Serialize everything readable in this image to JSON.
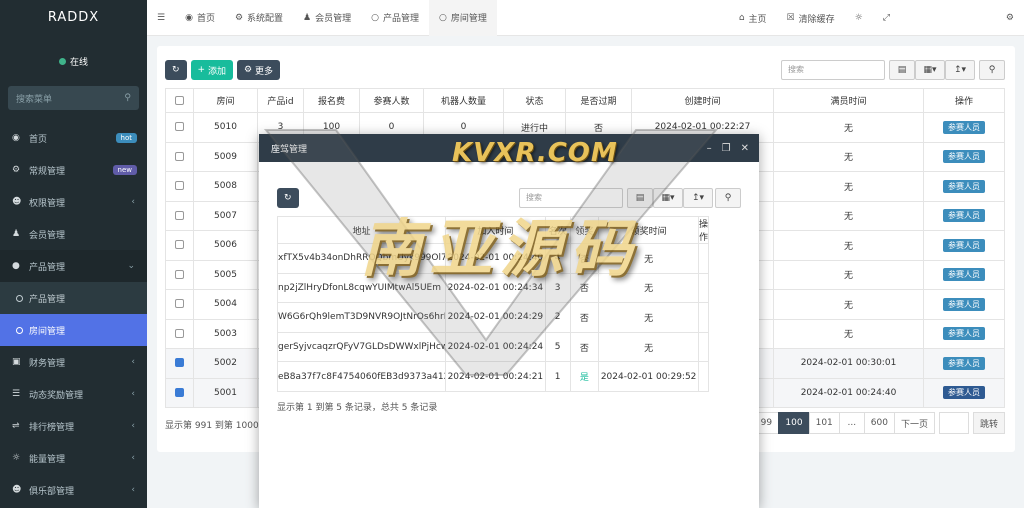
{
  "app": {
    "brand": "RADDX"
  },
  "user": {
    "status": "在线"
  },
  "sidebar": {
    "search_placeholder": "搜索菜单",
    "items": [
      {
        "label": "首页",
        "badge": "hot"
      },
      {
        "label": "常规管理",
        "badge": "new"
      },
      {
        "label": "权限管理"
      },
      {
        "label": "会员管理"
      },
      {
        "label": "产品管理"
      },
      {
        "label": "产品管理"
      },
      {
        "label": "房间管理"
      },
      {
        "label": "财务管理"
      },
      {
        "label": "动态奖励管理"
      },
      {
        "label": "排行榜管理"
      },
      {
        "label": "能量管理"
      },
      {
        "label": "俱乐部管理"
      }
    ]
  },
  "topbar": {
    "tabs": [
      "首页",
      "系统配置",
      "会员管理",
      "产品管理",
      "房间管理"
    ],
    "right": [
      "主页",
      "清除缓存"
    ]
  },
  "toolbar": {
    "add": "添加",
    "more": "更多",
    "search_placeholder": "搜索"
  },
  "table": {
    "headers": [
      "房间",
      "产品id",
      "报名费",
      "参赛人数",
      "机器人数量",
      "状态",
      "是否过期",
      "创建时间",
      "满员时间",
      "操作"
    ],
    "rows": [
      {
        "room": "5010",
        "pid": "3",
        "fee": "100",
        "players": "0",
        "bots": "0",
        "status": "进行中",
        "expired": "否",
        "created": "2024-02-01 00:22:27",
        "full": "无",
        "action": "参赛人员"
      },
      {
        "room": "5009",
        "full": "无",
        "action": "参赛人员"
      },
      {
        "room": "5008",
        "full": "无",
        "action": "参赛人员"
      },
      {
        "room": "5007",
        "full": "无",
        "action": "参赛人员"
      },
      {
        "room": "5006",
        "full": "无",
        "action": "参赛人员"
      },
      {
        "room": "5005",
        "full": "无",
        "action": "参赛人员"
      },
      {
        "room": "5004",
        "full": "无",
        "action": "参赛人员"
      },
      {
        "room": "5003",
        "full": "无",
        "action": "参赛人员"
      },
      {
        "room": "5002",
        "full": "2024-02-01 00:30:01",
        "action": "参赛人员"
      },
      {
        "room": "5001",
        "full": "2024-02-01 00:24:40",
        "action": "参赛人员"
      }
    ]
  },
  "pagination": {
    "info": "显示第 991 到第 1000 条",
    "pages": [
      "99",
      "100",
      "101",
      "...",
      "600",
      "下一页"
    ],
    "jump": "跳转"
  },
  "modal": {
    "title": "座驾管理",
    "search_placeholder": "搜索",
    "headers": [
      "地址",
      "加入时间",
      "名次",
      "领奖",
      "领奖时间",
      "操作"
    ],
    "rows": [
      {
        "addr": "xfTX5v4b34onDhRROQbmUyk999Ol76",
        "joined": "2024-02-01 00:24:40",
        "rank": "4",
        "claimed": "否",
        "claim_time": "无"
      },
      {
        "addr": "np2jZlHryDfonL8cqwYUIMtwAl5UEm",
        "joined": "2024-02-01 00:24:34",
        "rank": "3",
        "claimed": "否",
        "claim_time": "无"
      },
      {
        "addr": "W6G6rQh9lemT3D9NVR9OJtNrOs6hrE",
        "joined": "2024-02-01 00:24:29",
        "rank": "2",
        "claimed": "否",
        "claim_time": "无"
      },
      {
        "addr": "gerSyjvcaqzrQFyV7GLDsDWWxlPjHcw",
        "joined": "2024-02-01 00:24:24",
        "rank": "5",
        "claimed": "否",
        "claim_time": "无"
      },
      {
        "addr": "eB8a37f7c8F4754060fEB3d9373a412",
        "joined": "2024-02-01 00:24:21",
        "rank": "1",
        "claimed": "是",
        "claim_time": "2024-02-01 00:29:52"
      }
    ],
    "info": "显示第 1 到第 5 条记录，总共 5 条记录"
  },
  "watermark": {
    "site": "KVXR.COM",
    "text": "南亚源码"
  }
}
